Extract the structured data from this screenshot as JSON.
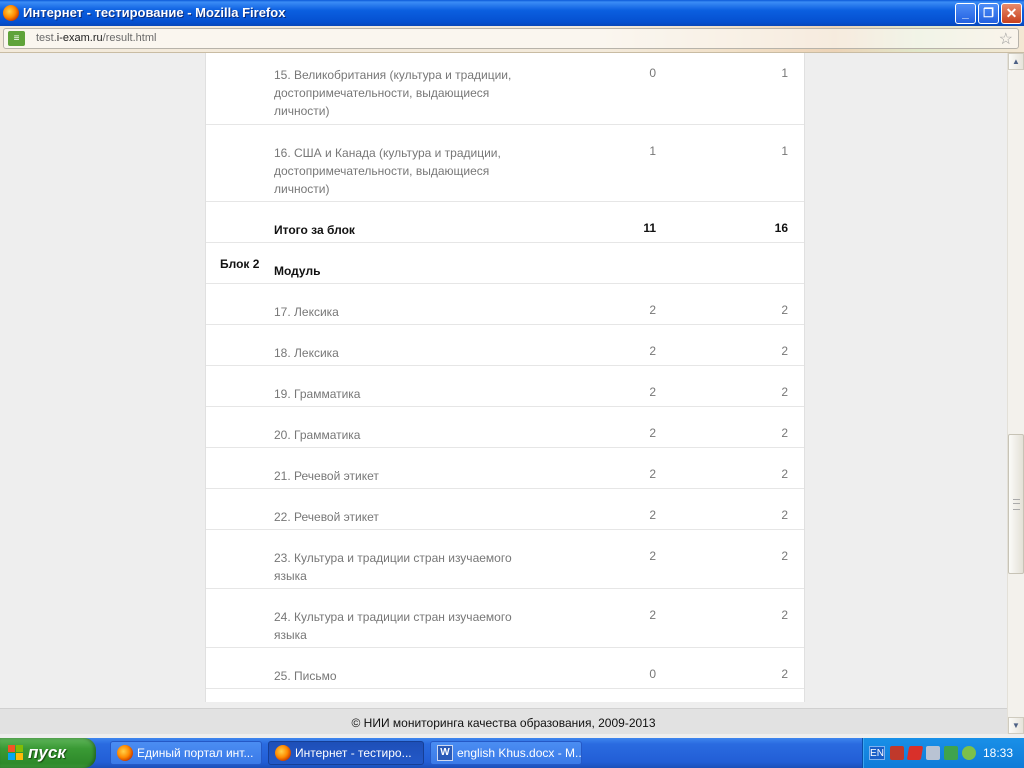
{
  "window": {
    "title": "Интернет - тестирование - Mozilla Firefox",
    "buttons": {
      "minimize": "_",
      "restore": "❐",
      "close": "✕"
    }
  },
  "urlbar": {
    "url_prefix": "test.",
    "url_domain": "i-exam.ru",
    "url_path": "/result.html"
  },
  "results": {
    "rows": [
      {
        "block": "",
        "name": "15. Великобритания (культура и традиции, достопримечательности, выдающиеся личности)",
        "v1": "0",
        "v2": "1",
        "style": "normal"
      },
      {
        "block": "",
        "name": "16. США и Канада (культура и традиции, достопримечательности, выдающиеся личности)",
        "v1": "1",
        "v2": "1",
        "style": "normal"
      },
      {
        "block": "",
        "name": "Итого за блок",
        "v1": "11",
        "v2": "16",
        "style": "bold"
      },
      {
        "block": "Блок 2",
        "name": "Модуль",
        "v1": "",
        "v2": "",
        "style": "header"
      },
      {
        "block": "",
        "name": "17. Лексика",
        "v1": "2",
        "v2": "2",
        "style": "normal"
      },
      {
        "block": "",
        "name": "18. Лексика",
        "v1": "2",
        "v2": "2",
        "style": "normal"
      },
      {
        "block": "",
        "name": "19. Грамматика",
        "v1": "2",
        "v2": "2",
        "style": "normal"
      },
      {
        "block": "",
        "name": "20. Грамматика",
        "v1": "2",
        "v2": "2",
        "style": "normal"
      },
      {
        "block": "",
        "name": "21. Речевой этикет",
        "v1": "2",
        "v2": "2",
        "style": "normal"
      },
      {
        "block": "",
        "name": "22. Речевой этикет",
        "v1": "2",
        "v2": "2",
        "style": "normal"
      },
      {
        "block": "",
        "name": "23. Культура и традиции стран изучаемого языка",
        "v1": "2",
        "v2": "2",
        "style": "normal"
      },
      {
        "block": "",
        "name": "24. Культура и традиции стран изучаемого языка",
        "v1": "2",
        "v2": "2",
        "style": "normal"
      },
      {
        "block": "",
        "name": "25. Письмо",
        "v1": "0",
        "v2": "2",
        "style": "normal"
      }
    ]
  },
  "footer": {
    "text": "© НИИ мониторинга качества образования, 2009-2013"
  },
  "taskbar": {
    "start_label": "пуск",
    "tasks": [
      {
        "label": "Единый портал инт...",
        "icon": "firefox-icon",
        "active": false
      },
      {
        "label": "Интернет - тестиро...",
        "icon": "firefox-icon",
        "active": true
      },
      {
        "label": "english Khus.docx - M...",
        "icon": "word-icon",
        "active": false
      }
    ],
    "tray": {
      "lang": "EN",
      "clock": "18:33"
    }
  },
  "colors": {
    "accent_blue": "#0b5fe0",
    "start_green": "#3a9a35",
    "text_muted": "#777777"
  }
}
